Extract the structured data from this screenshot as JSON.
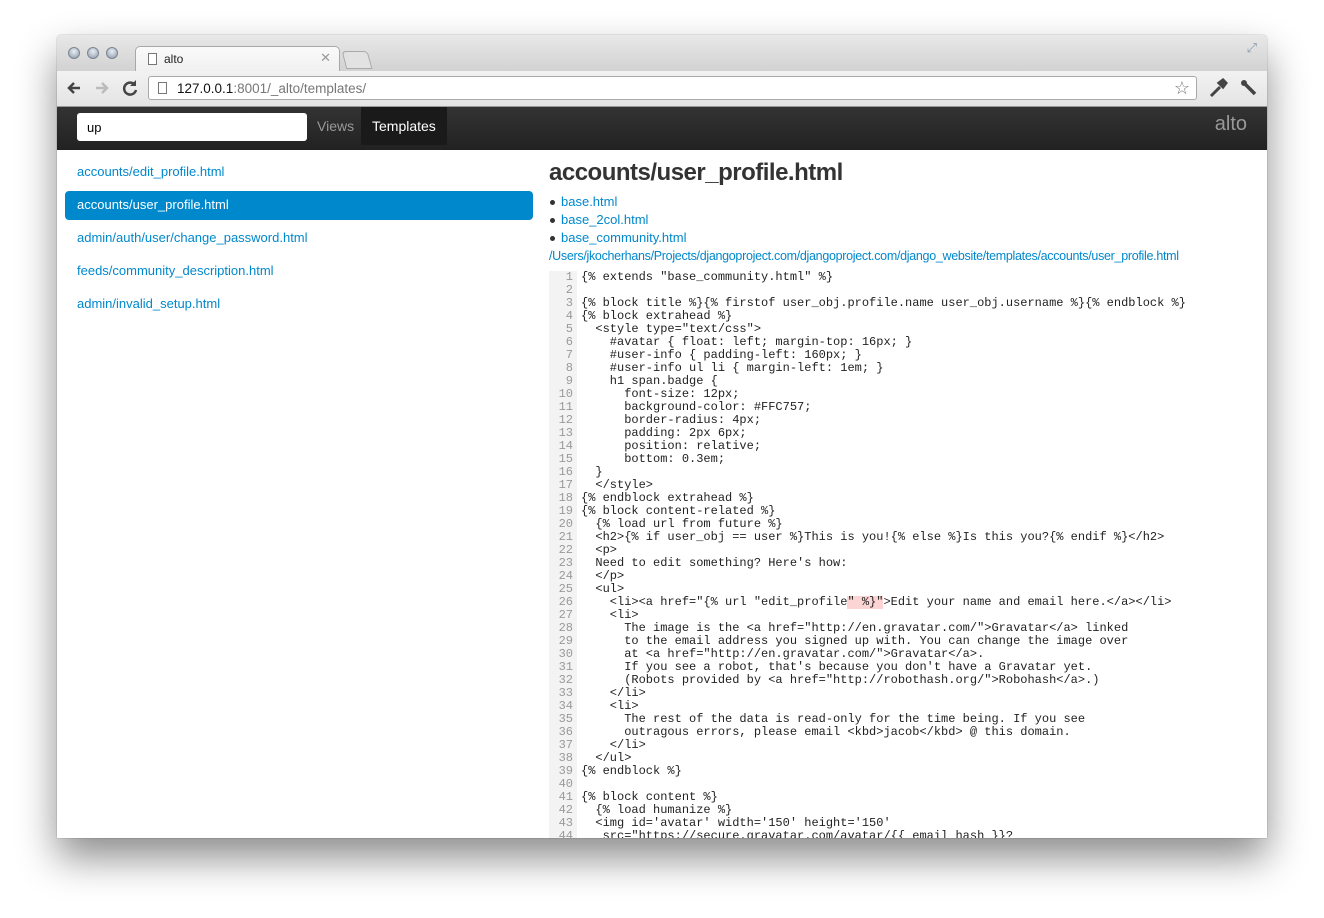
{
  "browser": {
    "tab_title": "alto",
    "url_host": "127.0.0.1",
    "url_rest": ":8001/_alto/templates/",
    "icons": [
      "back-icon",
      "forward-icon",
      "reload-icon",
      "star-icon",
      "pen-icon",
      "wrench-icon",
      "fullscreen-icon"
    ]
  },
  "navbar": {
    "search_value": "up",
    "views_label": "Views",
    "templates_label": "Templates",
    "brand": "alto"
  },
  "sidebar": {
    "items": [
      {
        "label": "accounts/edit_profile.html",
        "active": false
      },
      {
        "label": "accounts/user_profile.html",
        "active": true
      },
      {
        "label": "admin/auth/user/change_password.html",
        "active": false
      },
      {
        "label": "feeds/community_description.html",
        "active": false
      },
      {
        "label": "admin/invalid_setup.html",
        "active": false
      }
    ]
  },
  "main": {
    "title": "accounts/user_profile.html",
    "parents": [
      "base.html",
      "base_2col.html",
      "base_community.html"
    ],
    "path": "/Users/jkocherhans/Projects/djangoproject.com/djangoproject.com/django_website/templates/accounts/user_profile.html",
    "code": [
      "{% extends \"base_community.html\" %}",
      "",
      "{% block title %}{% firstof user_obj.profile.name user_obj.username %}{% endblock %}",
      "{% block extrahead %}",
      "  <style type=\"text/css\">",
      "    #avatar { float: left; margin-top: 16px; }",
      "    #user-info { padding-left: 160px; }",
      "    #user-info ul li { margin-left: 1em; }",
      "    h1 span.badge {",
      "      font-size: 12px;",
      "      background-color: #FFC757;",
      "      border-radius: 4px;",
      "      padding: 2px 6px;",
      "      position: relative;",
      "      bottom: 0.3em;",
      "  }",
      "  </style>",
      "{% endblock extrahead %}",
      "{% block content-related %}",
      "  {% load url from future %}",
      "  <h2>{% if user_obj == user %}This is you!{% else %}Is this you?{% endif %}</h2>",
      "  <p>",
      "  Need to edit something? Here's how:",
      "  </p>",
      "  <ul>",
      "    <li><a href=\"{% url \"edit_profile\" %}\">Edit your name and email here.</a></li>",
      "    <li>",
      "      The image is the <a href=\"http://en.gravatar.com/\">Gravatar</a> linked",
      "      to the email address you signed up with. You can change the image over",
      "      at <a href=\"http://en.gravatar.com/\">Gravatar</a>.",
      "      If you see a robot, that's because you don't have a Gravatar yet.",
      "      (Robots provided by <a href=\"http://robothash.org/\">Robohash</a>.)",
      "    </li>",
      "    <li>",
      "      The rest of the data is read-only for the time being. If you see",
      "      outragous errors, please email <kbd>jacob</kbd> @ this domain.",
      "    </li>",
      "  </ul>",
      "{% endblock %}",
      "",
      "{% block content %}",
      "  {% load humanize %}",
      "  <img id='avatar' width='150' height='150'",
      "   src=\"https://secure.gravatar.com/avatar/{{ email_hash }}?"
    ],
    "error_line": 26
  },
  "colors": {
    "accent": "#0088cc",
    "navbar": "#222222",
    "string": "#8a6d1f",
    "error_highlight": "#fcd4d4"
  }
}
